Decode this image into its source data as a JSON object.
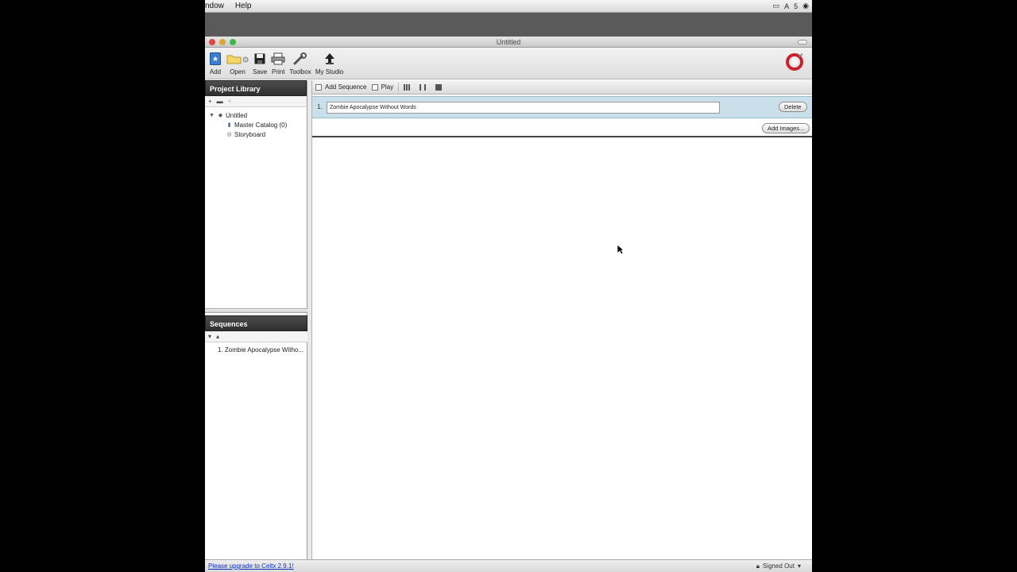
{
  "menubar": {
    "items": [
      "ndow",
      "Help"
    ],
    "right_text": "5"
  },
  "window": {
    "title": "Untitled"
  },
  "toolbar": {
    "buttons": [
      {
        "label": "Add",
        "icon": "add-star-icon"
      },
      {
        "label": "Open",
        "icon": "folder-icon"
      },
      {
        "label": "Save",
        "icon": "floppy-icon"
      },
      {
        "label": "Print",
        "icon": "printer-icon"
      },
      {
        "label": "Toolbox",
        "icon": "wrench-icon"
      },
      {
        "label": "My Studio",
        "icon": "studio-icon"
      }
    ]
  },
  "project_library": {
    "title": "Project Library",
    "tree": [
      {
        "label": "Untitled",
        "level": 0,
        "icon": "project-icon",
        "expanded": true
      },
      {
        "label": "Master Catalog (0)",
        "level": 1,
        "icon": "catalog-icon"
      },
      {
        "label": "Storyboard",
        "level": 1,
        "icon": "storyboard-icon"
      }
    ]
  },
  "sequences_panel": {
    "title": "Sequences",
    "items": [
      "1. Zombie Apocalypse Witho..."
    ]
  },
  "main": {
    "toolbar": {
      "add_sequence": "Add Sequence",
      "play": "Play"
    },
    "sequence": {
      "number": "1.",
      "title": "Zombie Apocalypse Without Words",
      "delete_label": "Delete",
      "add_images_label": "Add Images..."
    }
  },
  "statusbar": {
    "upgrade_text": "Please upgrade to Celtx 2.9.1!",
    "sign_status": "Signed Out"
  },
  "colors": {
    "sequence_row": "#c9e0ea",
    "panel_header": "#3a3a3a",
    "link": "#1030c0"
  }
}
